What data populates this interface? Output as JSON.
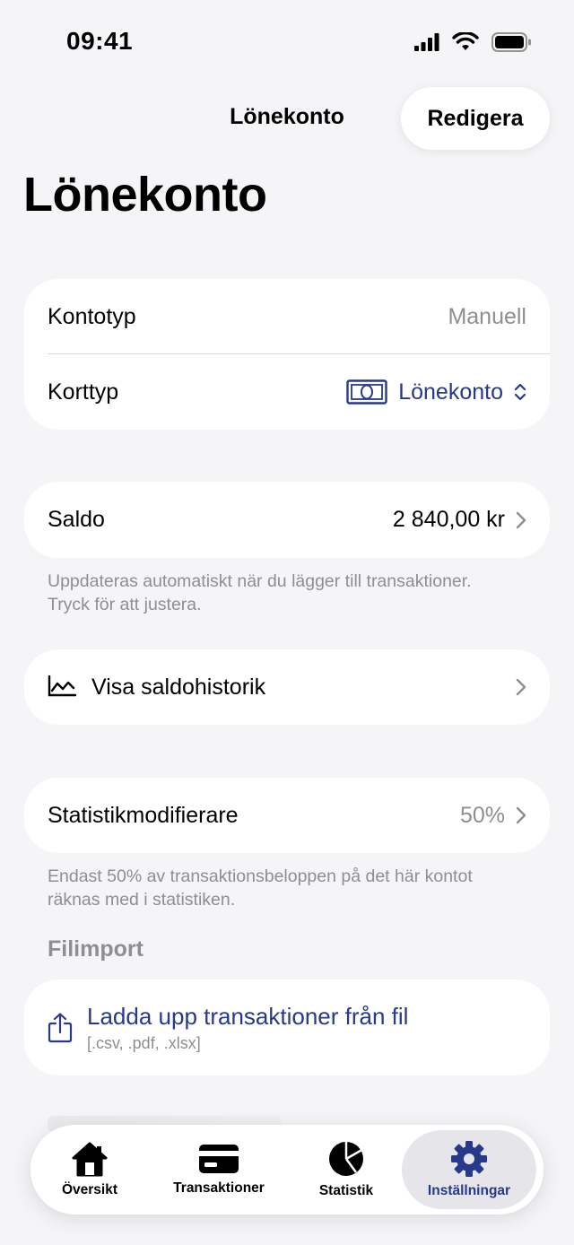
{
  "status_bar": {
    "time": "09:41"
  },
  "nav": {
    "title": "Lönekonto",
    "edit_label": "Redigera"
  },
  "page_title": "Lönekonto",
  "account_card": {
    "kontotyp_label": "Kontotyp",
    "kontotyp_value": "Manuell",
    "korttyp_label": "Korttyp",
    "korttyp_value": "Lönekonto"
  },
  "saldo": {
    "label": "Saldo",
    "value": "2 840,00 kr",
    "footnote": "Uppdateras automatiskt när du lägger till transaktioner. Tryck för att justera."
  },
  "history": {
    "label": "Visa saldohistorik"
  },
  "stat_modifier": {
    "label": "Statistikmodifierare",
    "value": "50%",
    "footnote": "Endast 50% av transaktionsbeloppen på det här kontot räknas med i statistiken."
  },
  "file_import": {
    "header": "Filimport",
    "title": "Ladda upp transaktioner från fil",
    "formats": "[.csv, .pdf, .xlsx]"
  },
  "tabs": [
    {
      "label": "Översikt",
      "icon": "house-icon"
    },
    {
      "label": "Transaktioner",
      "icon": "card-icon"
    },
    {
      "label": "Statistik",
      "icon": "pie-chart-icon"
    },
    {
      "label": "Inställningar",
      "icon": "gear-icon"
    }
  ],
  "colors": {
    "accent": "#26398a",
    "secondary": "#8e8e93",
    "background": "#f5f5f7"
  }
}
